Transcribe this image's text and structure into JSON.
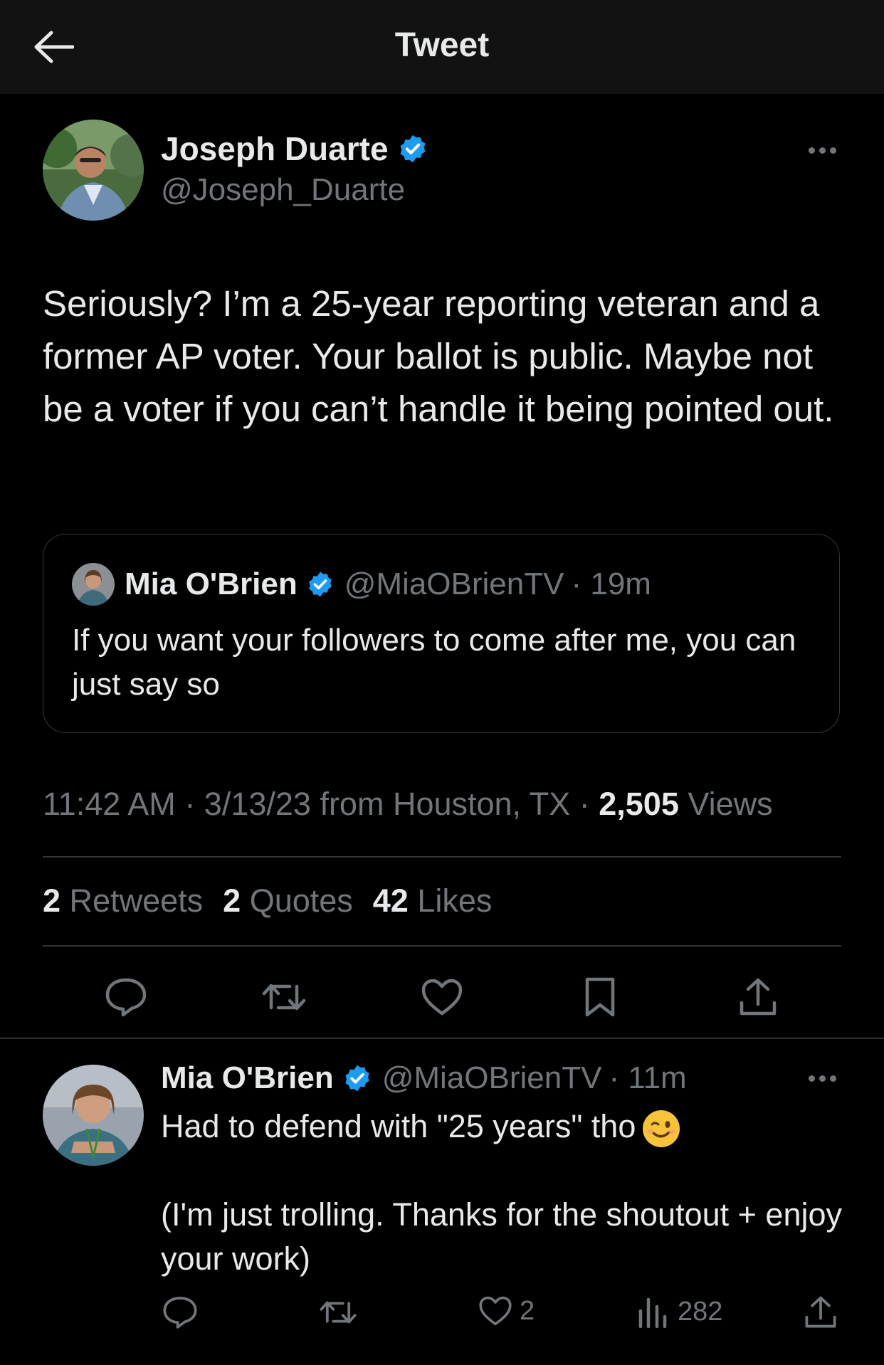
{
  "header": {
    "title": "Tweet"
  },
  "tweet": {
    "author_name": "Joseph Duarte",
    "author_handle": "@Joseph_Duarte",
    "text": "Seriously? I’m a 25-year reporting veteran and a former AP voter. Your ballot is public. Maybe not be a voter if you can’t handle it being pointed out.",
    "quoted": {
      "author_name": "Mia O'Brien",
      "author_handle": "@MiaOBrienTV",
      "time": "· 19m",
      "text": "If you want your followers to come after me, you can just say so"
    },
    "meta": {
      "time": "11:42 AM",
      "date": "· 3/13/23 from Houston, TX ·",
      "views_count": "2,505",
      "views_label": "Views"
    },
    "stats": {
      "retweets_count": "2",
      "retweets_label": "Retweets",
      "quotes_count": "2",
      "quotes_label": "Quotes",
      "likes_count": "42",
      "likes_label": "Likes"
    }
  },
  "reply": {
    "author_name": "Mia O'Brien",
    "author_handle": "@MiaOBrienTV",
    "time": "· 11m",
    "line1": "Had to defend with \"25 years\" tho",
    "line2": "(I'm just trolling. Thanks for the shoutout + enjoy your work)",
    "likes": "2",
    "views": "282"
  },
  "colors": {
    "verified": "#1d9bf0",
    "muted": "#71767b",
    "text": "#e7e9ea",
    "background": "#000000"
  },
  "icons": [
    "back-arrow-icon",
    "more-icon",
    "verified-icon",
    "reply-icon",
    "retweet-icon",
    "like-icon",
    "bookmark-icon",
    "share-icon",
    "views-icon",
    "wink-emoji"
  ]
}
